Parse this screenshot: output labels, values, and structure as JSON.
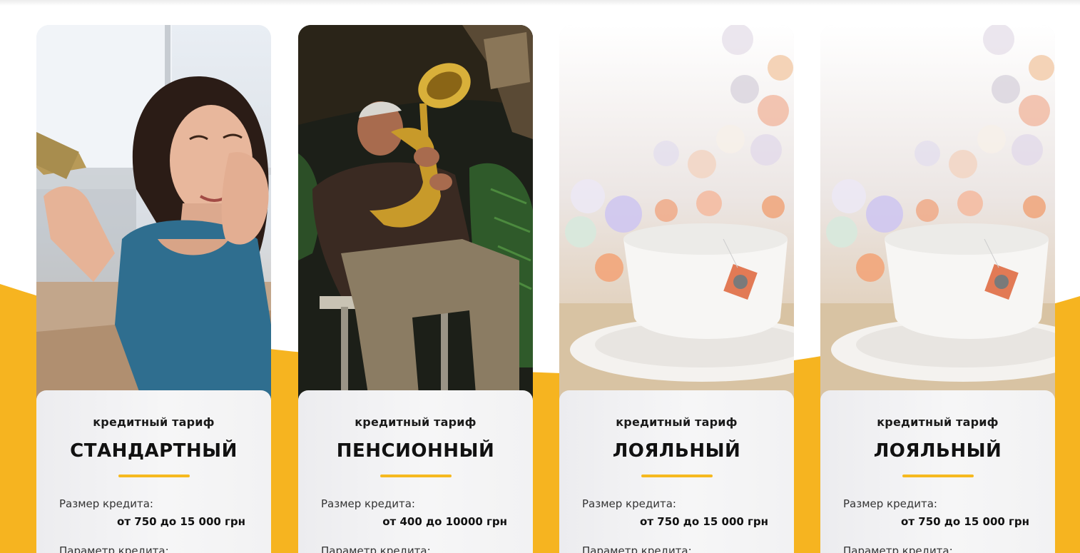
{
  "colors": {
    "accent": "#f6b91f",
    "card_panel": "#f2f2f3",
    "text_dark": "#111111"
  },
  "cards": [
    {
      "photo": "woman-with-credit-card-photo",
      "kind": "кредитный тариф",
      "name": "СТАНДАРТНЫЙ",
      "size_label": "Размер кредита:",
      "size_value": "от 750 до 15 000 грн",
      "param_label": "Параметр кредита:"
    },
    {
      "photo": "man-playing-horn-photo",
      "kind": "кредитный тариф",
      "name": "ПЕНСИОННЫЙ",
      "size_label": "Размер кредита:",
      "size_value": "от 400 до 10000 грн",
      "param_label": "Параметр кредита:"
    },
    {
      "photo": "tea-cup-bokeh-photo",
      "kind": "кредитный тариф",
      "name": "ЛОЯЛЬНЫЙ",
      "size_label": "Размер кредита:",
      "size_value": "от 750 до 15 000 грн",
      "param_label": "Параметр кредита:"
    },
    {
      "photo": "tea-cup-bokeh-photo",
      "kind": "кредитный тариф",
      "name": "ЛОЯЛЬНЫЙ",
      "size_label": "Размер кредита:",
      "size_value": "от 750 до 15 000 грн",
      "param_label": "Параметр кредита:"
    }
  ]
}
